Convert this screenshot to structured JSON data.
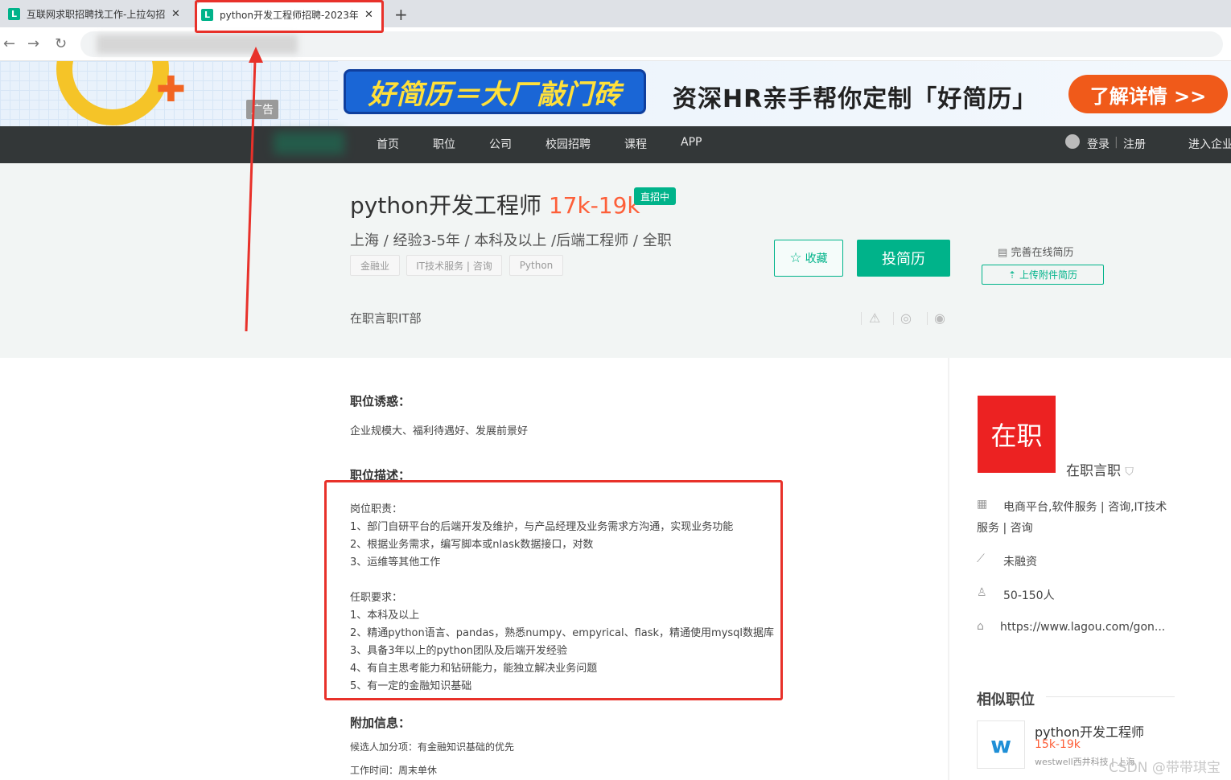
{
  "browser": {
    "tabs": [
      {
        "favicon": "L",
        "title": "互联网求职招聘找工作-上拉勾招",
        "close": "✕"
      },
      {
        "favicon": "L",
        "title": "python开发工程师招聘-2023年",
        "close": "✕"
      }
    ],
    "new_tab": "+",
    "nav": {
      "back": "←",
      "forward": "→",
      "reload": "↻"
    }
  },
  "ad": {
    "slogan": "好简历＝大厂敲门砖",
    "text": "资深HR亲手帮你定制「好简历」",
    "button": "了解详情 >>",
    "tag": "广告"
  },
  "nav": {
    "links": [
      "首页",
      "职位",
      "公司",
      "校园招聘",
      "课程",
      "APP"
    ],
    "login": "登录",
    "register": "注册",
    "enterprise": "进入企业"
  },
  "job": {
    "title": "python开发工程师",
    "salary": "17k-19k",
    "hiring_badge": "直招中",
    "subline": "上海 / 经验3-5年 / 本科及以上 /后端工程师 / 全职",
    "tags": [
      "金融业",
      "IT技术服务 | 咨询",
      "Python"
    ],
    "favorite": "收藏",
    "apply": "投简历",
    "complete_resume": "完善在线简历",
    "upload_resume": "上传附件简历",
    "company_short": "在职言职IT部"
  },
  "detail": {
    "perks_title": "职位诱惑：",
    "perks": "企业规模大、福利待遇好、发展前景好",
    "desc_title": "职位描述：",
    "desc_lines": [
      "岗位职责：",
      "1、部门自研平台的后端开发及维护，与产品经理及业务需求方沟通，实现业务功能",
      "2、根据业务需求，编写脚本或nlask数据接口，对数",
      "3、运维等其他工作",
      "",
      "任职要求：",
      "1、本科及以上",
      "2、精通python语言、pandas，熟悉numpy、empyrical、flask，精通使用mysql数据库",
      "3、具备3年以上的python团队及后端开发经验",
      "4、有自主思考能力和钻研能力，能独立解决业务问题",
      "5、有一定的金融知识基础"
    ],
    "extra_title": "附加信息：",
    "extra_lines": [
      "候选人加分项：有金融知识基础的优先",
      "工作时间：周末单休"
    ]
  },
  "company": {
    "logo_text": "在职",
    "name": "在职言职",
    "industry_line1": "电商平台,软件服务 | 咨询,IT技术",
    "industry_line2": "服务 | 咨询",
    "funding": "未融资",
    "size": "50-150人",
    "website": "https://www.lagou.com/gon..."
  },
  "similar": {
    "heading": "相似职位",
    "items": [
      {
        "logo": "w",
        "title": "python开发工程师",
        "salary": "15k-19k",
        "company": "westwell西井科技 | 上海"
      }
    ]
  },
  "watermark": "CSDN @带带琪宝",
  "colors": {
    "brand": "#00b38a",
    "salary": "#fd5f39",
    "annotation": "#e8312a",
    "nav_bg": "#333738"
  }
}
